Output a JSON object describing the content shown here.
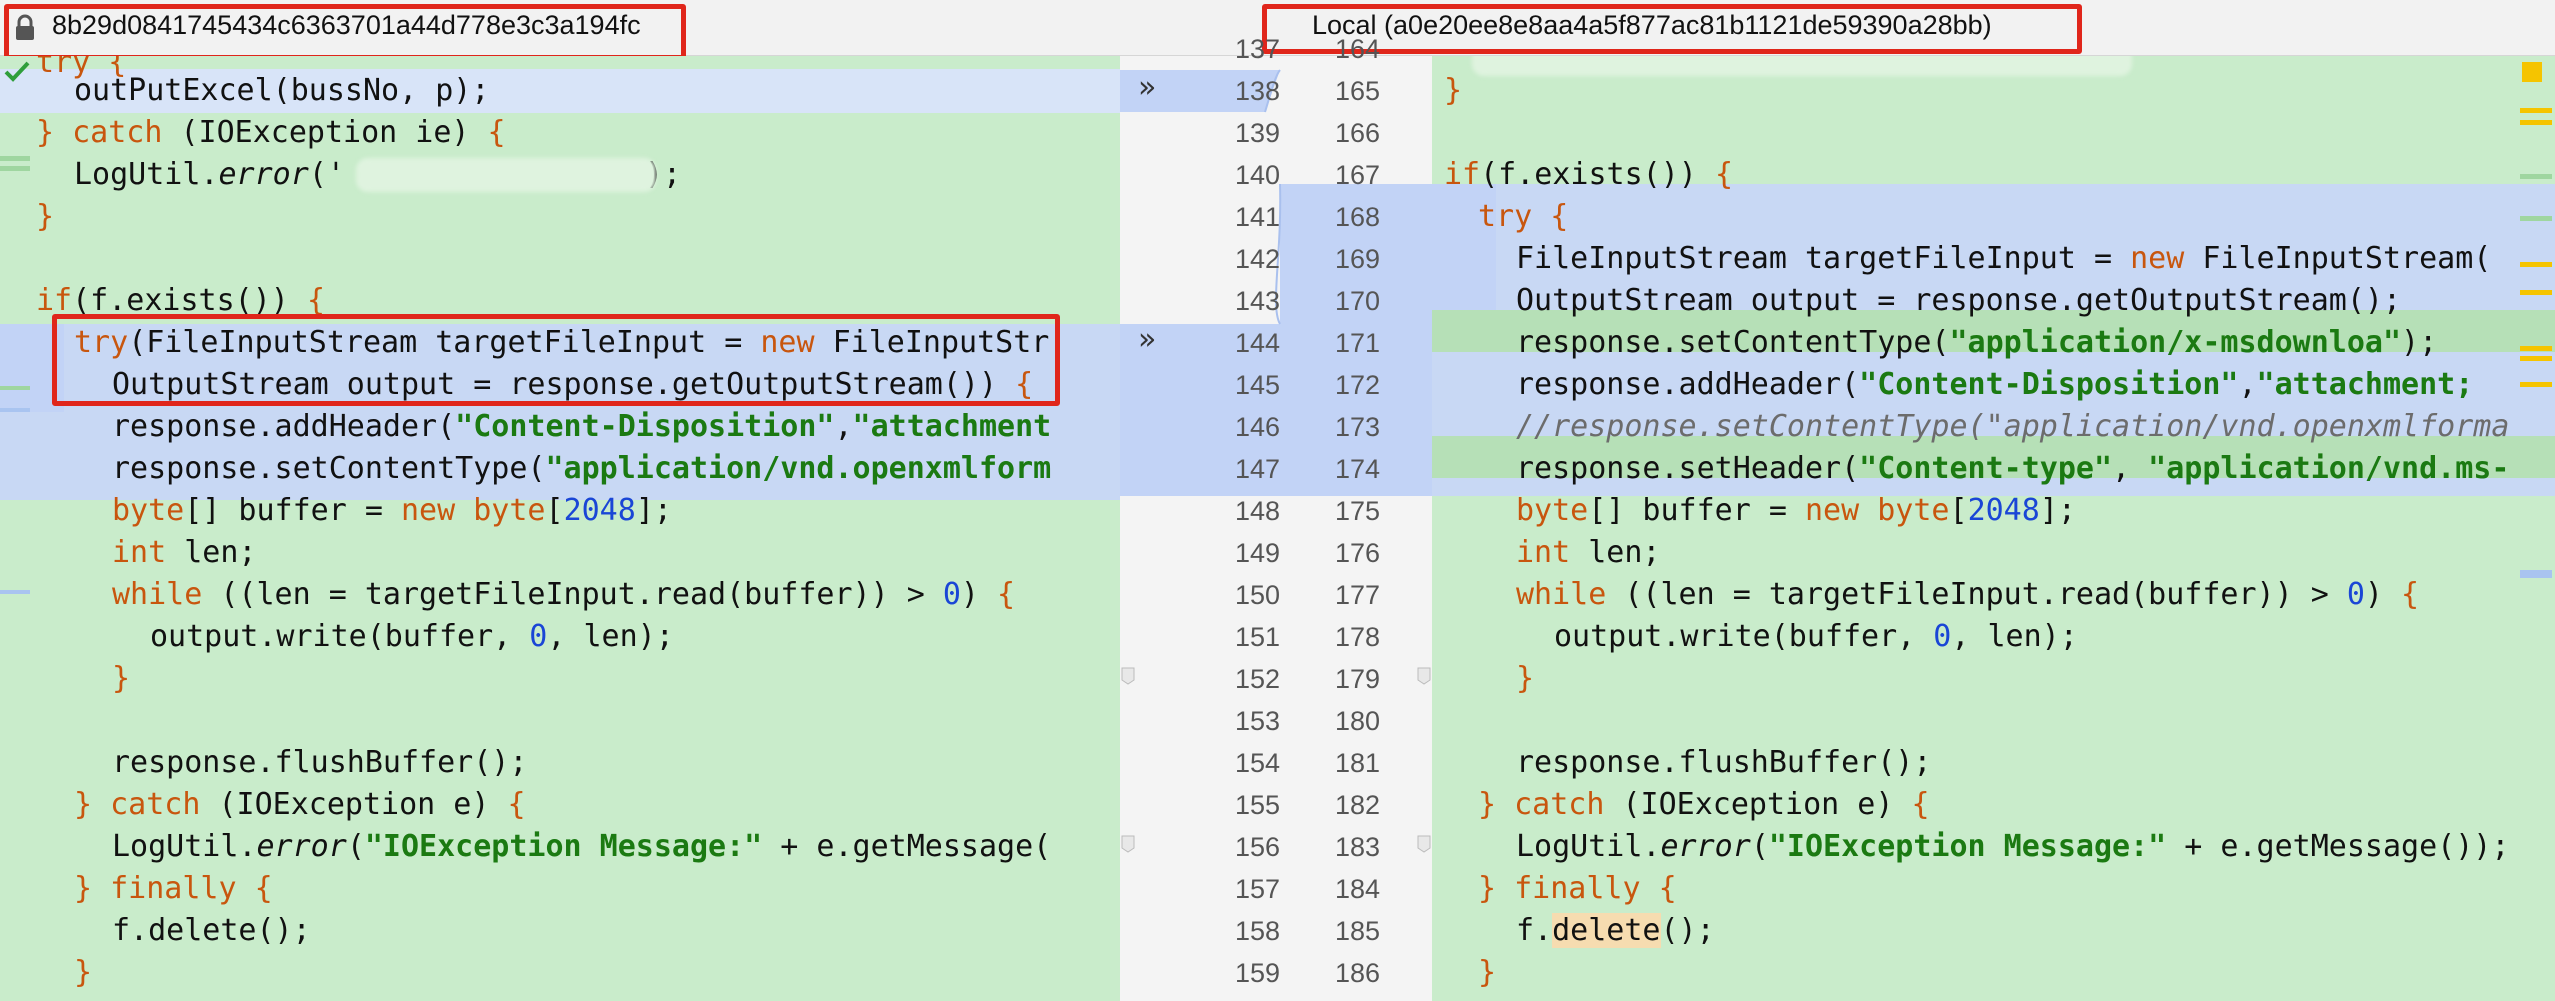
{
  "header": {
    "left_title": "8b29d0841745434c6363701a44d778e3c3a194fc",
    "right_title": "Local (a0e20ee8e8aa4a5f877ac81b1121de59390a28bb)"
  },
  "gutter": {
    "left_numbers": [
      "137",
      "138",
      "139",
      "140",
      "141",
      "142",
      "143",
      "144",
      "145",
      "146",
      "147",
      "148",
      "149",
      "150",
      "151",
      "152",
      "153",
      "154",
      "155",
      "156",
      "157",
      "158",
      "159"
    ],
    "right_numbers": [
      "164",
      "165",
      "166",
      "167",
      "168",
      "169",
      "170",
      "171",
      "172",
      "173",
      "174",
      "175",
      "176",
      "177",
      "178",
      "179",
      "180",
      "181",
      "182",
      "183",
      "184",
      "185",
      "186"
    ]
  },
  "left": {
    "l0": "try {",
    "l1": "outPutExcel(bussNo, p);",
    "l2a": "} ",
    "l2b": "catch",
    "l2c": " (IOException ie) ",
    "l2d": "{",
    "l3a": "LogUtil.",
    "l3b": "error",
    "l3c": "('",
    "l3d": ");",
    "l4": "}",
    "l6a": "if",
    "l6b": "(f.exists()) ",
    "l6c": "{",
    "l7a": "try",
    "l7b": "(FileInputStream targetFileInput = ",
    "l7c": "new",
    "l7d": " FileInputStr",
    "l8a": "OutputStream output = response.getOutputStream()) ",
    "l8b": "{",
    "l9a": "response.addHeader(",
    "l9b": "\"Content-Disposition\"",
    "l9c": ",",
    "l9d": "\"attachment",
    "l10a": "response.setContentType(",
    "l10b": "\"application/vnd.openxmlform",
    "l11a": "byte",
    "l11b": "[] buffer = ",
    "l11c": "new",
    "l11d": " ",
    "l11e": "byte",
    "l11f": "[",
    "l11g": "2048",
    "l11h": "];",
    "l12a": "int",
    "l12b": " len;",
    "l13a": "while",
    "l13b": " ((len = targetFileInput.read(buffer)) > ",
    "l13c": "0",
    "l13d": ") ",
    "l13e": "{",
    "l14a": "output.write(buffer, ",
    "l14b": "0",
    "l14c": ", len);",
    "l15": "}",
    "l17": "response.flushBuffer();",
    "l18a": "} ",
    "l18b": "catch",
    "l18c": " (IOException e) ",
    "l18d": "{",
    "l19a": "LogUtil.",
    "l19b": "error",
    "l19c": "(",
    "l19d": "\"IOException Message:\"",
    "l19e": " + e.getMessage(",
    "l20a": "} ",
    "l20b": "finally",
    "l20c": " {",
    "l21": "f.delete();",
    "l22": "}"
  },
  "right": {
    "r1": "}",
    "r3a": "if",
    "r3b": "(f.exists()) ",
    "r3c": "{",
    "r4a": "try",
    "r4b": " {",
    "r5a": "FileInputStream targetFileInput = ",
    "r5b": "new",
    "r5c": " FileInputStream(",
    "r6": "OutputStream output = response.getOutputStream();",
    "r7a": "response.setContentType(",
    "r7b": "\"application/x-msdownloa\"",
    "r7c": ");",
    "r8a": "response.addHeader(",
    "r8b": "\"Content-Disposition\"",
    "r8c": ",",
    "r8d": "\"attachment;",
    "r9": "//response.setContentType(\"application/vnd.openxmlforma",
    "r10a": "response.setHeader(",
    "r10b": "\"Content-type\"",
    "r10c": ", ",
    "r10d": "\"application/vnd.ms-",
    "r11a": "byte",
    "r11b": "[] buffer = ",
    "r11c": "new",
    "r11d": " ",
    "r11e": "byte",
    "r11f": "[",
    "r11g": "2048",
    "r11h": "];",
    "r12a": "int",
    "r12b": " len;",
    "r13a": "while",
    "r13b": " ((len = targetFileInput.read(buffer)) > ",
    "r13c": "0",
    "r13d": ") ",
    "r13e": "{",
    "r14a": "output.write(buffer, ",
    "r14b": "0",
    "r14c": ", len);",
    "r15": "}",
    "r17": "response.flushBuffer();",
    "r18a": "} ",
    "r18b": "catch",
    "r18c": " (IOException e) ",
    "r18d": "{",
    "r19a": "LogUtil.",
    "r19b": "error",
    "r19c": "(",
    "r19d": "\"IOException Message:\"",
    "r19e": " + e.getMessage());",
    "r20a": "} ",
    "r20b": "finally",
    "r20c": " {",
    "r21a": "f.",
    "r21b": "delete",
    "r21c": "();",
    "r22": "}"
  },
  "colors": {
    "added_bg": "#c9eccb",
    "changed_bg": "#c2d3f6",
    "keyword": "#c8560e",
    "string": "#1b7a12",
    "number": "#1a46d6",
    "annotation_box": "#e0261b"
  }
}
